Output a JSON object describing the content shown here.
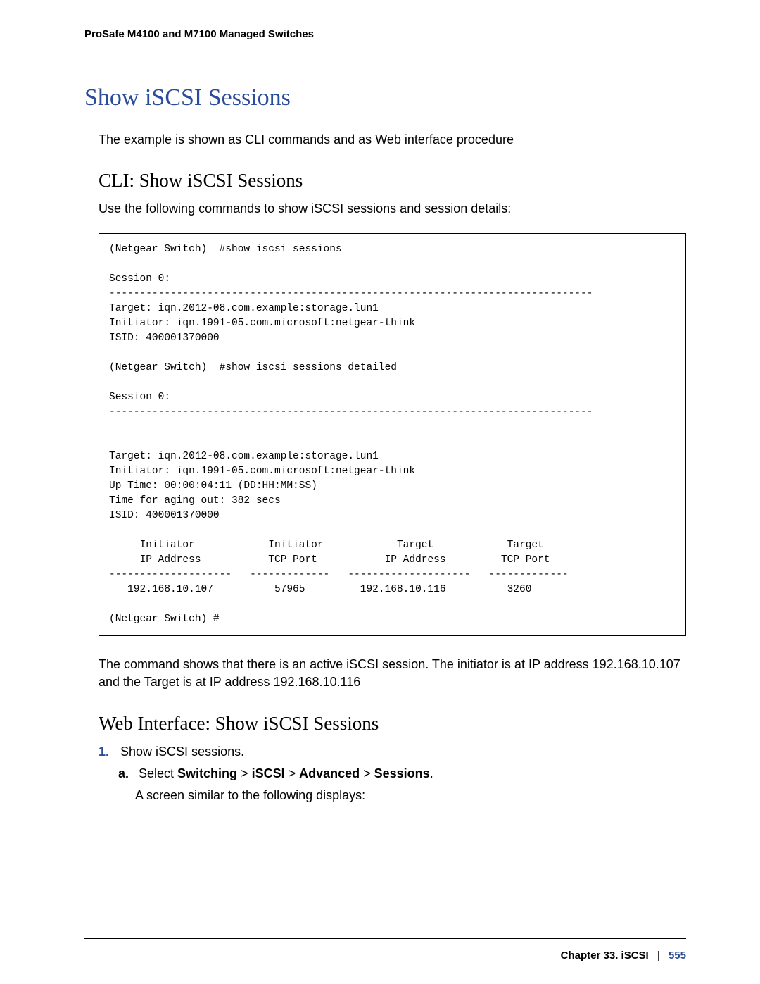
{
  "header": {
    "running": "ProSafe M4100 and M7100 Managed Switches"
  },
  "title": "Show iSCSI Sessions",
  "intro": "The example is shown as CLI commands and as Web interface procedure",
  "sections": {
    "cli": {
      "heading": "CLI: Show iSCSI Sessions",
      "lead": "Use the following commands to show iSCSI sessions and session details:",
      "code": "(Netgear Switch)  #show iscsi sessions\n\nSession 0:\n-------------------------------------------------------------------------------\nTarget: iqn.2012-08.com.example:storage.lun1\nInitiator: iqn.1991-05.com.microsoft:netgear-think\nISID: 400001370000\n\n(Netgear Switch)  #show iscsi sessions detailed\n\nSession 0:\n-------------------------------------------------------------------------------\n\n\nTarget: iqn.2012-08.com.example:storage.lun1\nInitiator: iqn.1991-05.com.microsoft:netgear-think\nUp Time: 00:00:04:11 (DD:HH:MM:SS)\nTime for aging out: 382 secs\nISID: 400001370000\n\n     Initiator            Initiator            Target            Target\n     IP Address           TCP Port           IP Address         TCP Port\n--------------------   -------------   --------------------   -------------\n   192.168.10.107          57965         192.168.10.116          3260\n\n(Netgear Switch) #",
      "post": "The command shows that there is an active iSCSI session. The initiator is at IP address 192.168.10.107 and the Target is at IP address 192.168.10.116"
    },
    "web": {
      "heading": "Web Interface: Show iSCSI Sessions",
      "step1_num": "1.",
      "step1_text": "Show iSCSI sessions.",
      "step1a_letter": "a.",
      "step1a_prefix": "Select ",
      "step1a_b1": "Switching",
      "step1a_gt1": " > ",
      "step1a_b2": "iSCSI",
      "step1a_gt2": " > ",
      "step1a_b3": "Advanced",
      "step1a_gt3": " > ",
      "step1a_b4": "Sessions",
      "step1a_suffix": ".",
      "step1a_line2": "A screen similar to the following displays:"
    }
  },
  "footer": {
    "chapter": "Chapter 33.  iSCSI",
    "separator": "|",
    "page": "555"
  }
}
